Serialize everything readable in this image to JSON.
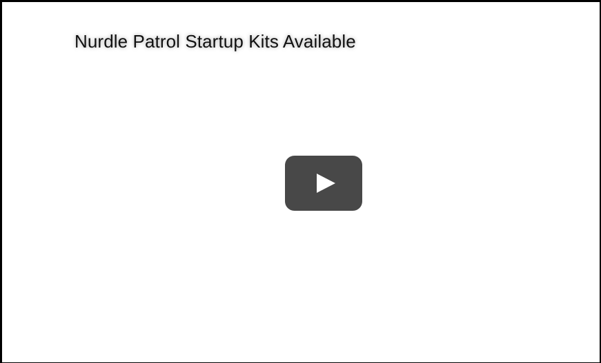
{
  "video": {
    "title": "Nurdle Patrol Startup Kits Available"
  },
  "play_button": {
    "icon": "play-icon",
    "background_color": "#484848",
    "glyph_color": "#ffffff"
  }
}
